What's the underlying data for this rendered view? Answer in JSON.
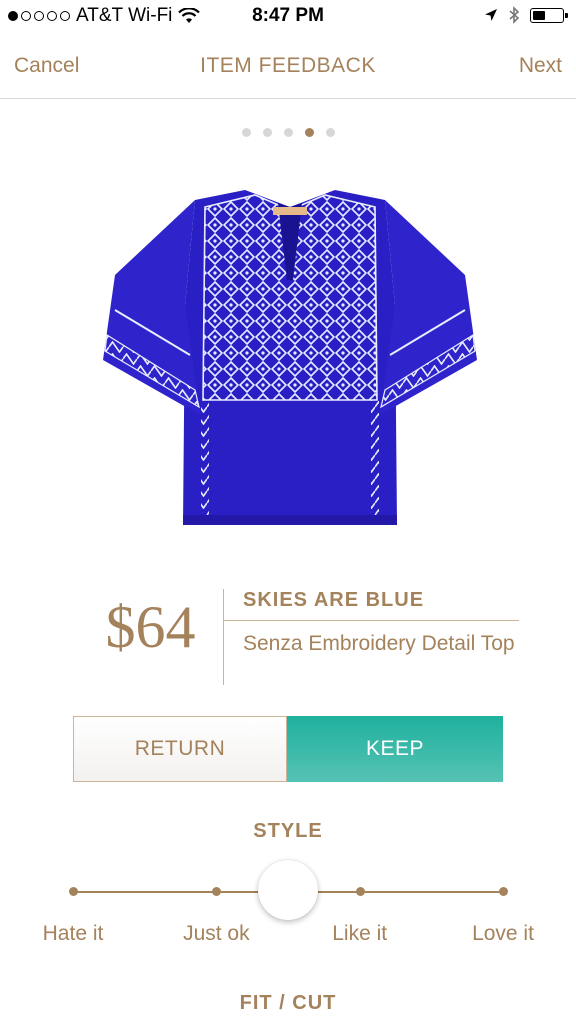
{
  "status_bar": {
    "carrier": "AT&T Wi-Fi",
    "time": "8:47 PM",
    "signal_bars_filled": 1,
    "signal_bars_total": 5,
    "battery_level": 0.45,
    "icons": [
      "wifi-icon",
      "location-arrow-icon",
      "bluetooth-icon",
      "battery-icon"
    ]
  },
  "nav": {
    "cancel_label": "Cancel",
    "title": "ITEM FEEDBACK",
    "next_label": "Next"
  },
  "pagination": {
    "total": 5,
    "active_index": 3
  },
  "product": {
    "price": "$64",
    "brand": "SKIES ARE BLUE",
    "name": "Senza Embroidery Detail Top",
    "image_description_icon": "blouse-image",
    "garment_color": "#2a1fc4"
  },
  "actions": {
    "return_label": "RETURN",
    "keep_label": "KEEP"
  },
  "style_section": {
    "title": "STYLE",
    "options": [
      "Hate it",
      "Just ok",
      "Like it",
      "Love it"
    ],
    "selected_value": 0.5
  },
  "fit_section": {
    "title": "FIT / CUT"
  },
  "colors": {
    "accent": "#a4825b",
    "keep": "#2bb5a2",
    "divider": "#cbb497"
  }
}
